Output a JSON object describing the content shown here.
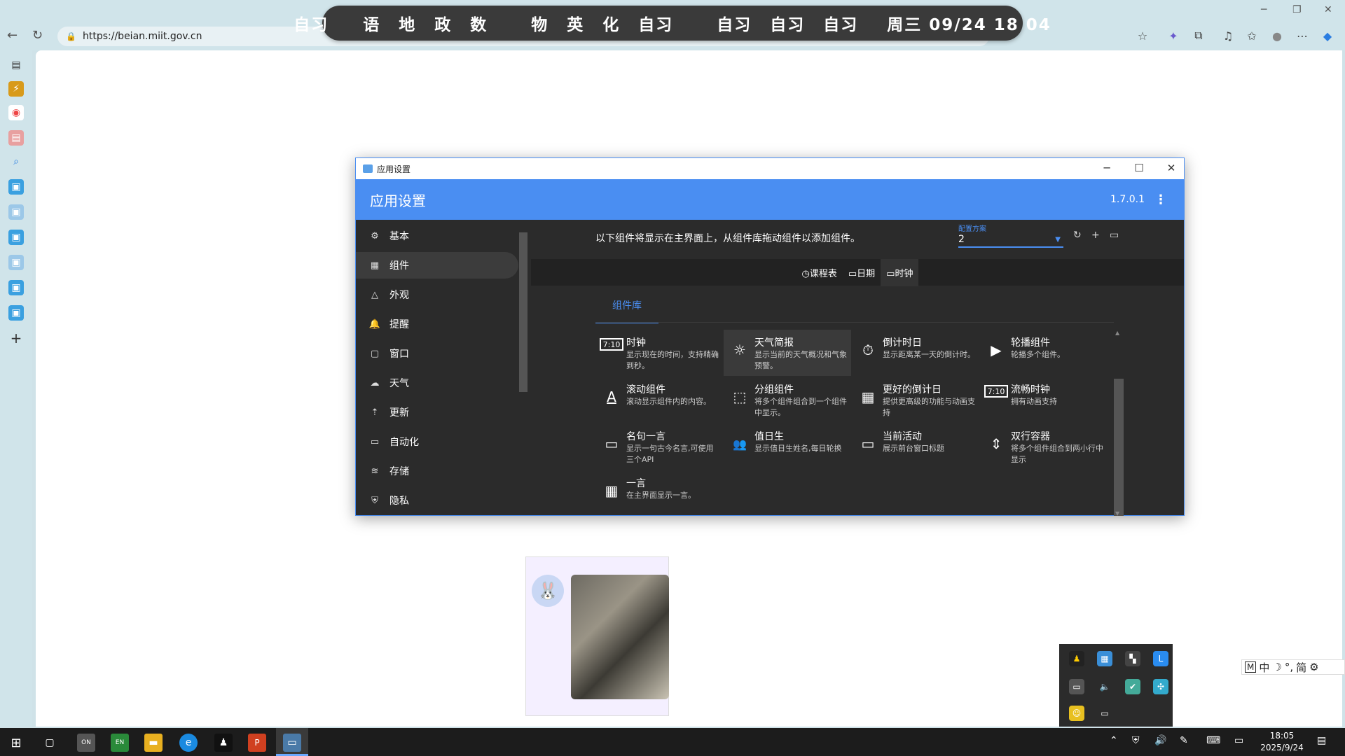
{
  "schedule": {
    "segments": [
      "自习",
      "语 地 政 数",
      "物 英 化 自习",
      "自习 自习 自习",
      "周三 09/24  18 04"
    ],
    "subjects_group2": [
      "语",
      "地",
      "政",
      "数"
    ],
    "subjects_group3": [
      "物",
      "英",
      "化",
      "自习"
    ],
    "subjects_group4": [
      "自习",
      "自习",
      "自习"
    ],
    "first": "自习",
    "datetime": "周三 09/24  18 04"
  },
  "browser": {
    "url": "https://beian.miit.gov.cn"
  },
  "app": {
    "window_title": "应用设置",
    "header_title": "应用设置",
    "version": "1.7.0.1",
    "nav": [
      {
        "label": "基本",
        "icon": "gear-icon",
        "glyph": "⚙"
      },
      {
        "label": "组件",
        "icon": "grid-icon",
        "glyph": "▦"
      },
      {
        "label": "外观",
        "icon": "shapes-icon",
        "glyph": "△"
      },
      {
        "label": "提醒",
        "icon": "bell-icon",
        "glyph": "🔔"
      },
      {
        "label": "窗口",
        "icon": "window-icon",
        "glyph": "▢"
      },
      {
        "label": "天气",
        "icon": "cloud-icon",
        "glyph": "☁"
      },
      {
        "label": "更新",
        "icon": "upload-icon",
        "glyph": "⇡"
      },
      {
        "label": "自动化",
        "icon": "automation-icon",
        "glyph": "▭"
      },
      {
        "label": "存储",
        "icon": "database-icon",
        "glyph": "≋"
      },
      {
        "label": "隐私",
        "icon": "shield-icon",
        "glyph": "⛨"
      }
    ],
    "instruction": "以下组件将显示在主界面上，从组件库拖动组件以添加组件。",
    "config": {
      "label": "配置方案",
      "value": "2"
    },
    "widget_tabs": [
      {
        "label": "◷课程表"
      },
      {
        "label": "▭日期"
      },
      {
        "label": "▭时钟"
      }
    ],
    "library_tab": "组件库",
    "widgets": [
      {
        "name": "时钟",
        "desc": "显示现在的时间，支持精确到秒。",
        "icon": "clock-icon",
        "glyph": "7:10"
      },
      {
        "name": "天气简报",
        "desc": "显示当前的天气概况和气象预警。",
        "icon": "sun-icon",
        "glyph": "☼"
      },
      {
        "name": "倒计时日",
        "desc": "显示距离某一天的倒计时。",
        "icon": "timer-icon",
        "glyph": "⏱"
      },
      {
        "name": "轮播组件",
        "desc": "轮播多个组件。",
        "icon": "play-icon",
        "glyph": "▶"
      },
      {
        "name": "滚动组件",
        "desc": "滚动显示组件内的内容。",
        "icon": "text-icon",
        "glyph": "A"
      },
      {
        "name": "分组组件",
        "desc": "将多个组件组合到一个组件中显示。",
        "icon": "group-icon",
        "glyph": "⬚"
      },
      {
        "name": "更好的倒计日",
        "desc": "提供更高级的功能与动画支持",
        "icon": "calendar-icon",
        "glyph": "▦"
      },
      {
        "name": "流畅时钟",
        "desc": "拥有动画支持",
        "icon": "smooth-clock-icon",
        "glyph": "7:10"
      },
      {
        "name": "名句一言",
        "desc": "显示一句古今名言,可使用三个API",
        "icon": "chat-icon",
        "glyph": "▭"
      },
      {
        "name": "值日生",
        "desc": "显示值日生姓名,每日轮换",
        "icon": "people-icon",
        "glyph": "👥"
      },
      {
        "name": "当前活动",
        "desc": "展示前台窗口标题",
        "icon": "monitor-icon",
        "glyph": "▭"
      },
      {
        "name": "双行容器",
        "desc": "将多个组件组合到两小行中显示",
        "icon": "split-icon",
        "glyph": "⇕"
      },
      {
        "name": "一言",
        "desc": "在主界面显示一言。",
        "icon": "calendar-icon",
        "glyph": "▦"
      }
    ]
  },
  "ime": {
    "mode": "M",
    "lang": "中",
    "punct": "°,",
    "script": "简"
  },
  "clock": {
    "time": "18:05",
    "date": "2025/9/24"
  },
  "colors": {
    "accent": "#4a8ef2",
    "dark_bg": "#2b2b2b",
    "taskbar": "#1c1c1c"
  }
}
